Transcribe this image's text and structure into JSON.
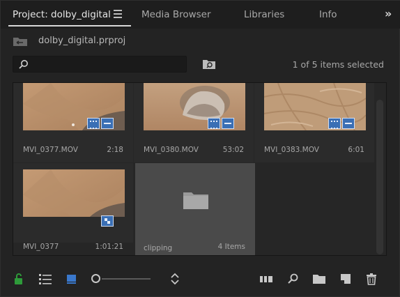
{
  "tabs": [
    {
      "label": "Project: dolby_digital",
      "active": true
    },
    {
      "label": "Media Browser",
      "active": false
    },
    {
      "label": "Libraries",
      "active": false
    },
    {
      "label": "Info",
      "active": false
    }
  ],
  "overflow_label": "»",
  "project_path": "dolby_digital.prproj",
  "search": {
    "placeholder": "",
    "value": ""
  },
  "selection_status": "1 of 5 items selected",
  "items": [
    {
      "name": "MVI_0377.MOV",
      "duration": "2:18"
    },
    {
      "name": "MVI_0380.MOV",
      "duration": "53:02"
    },
    {
      "name": "MVI_0383.MOV",
      "duration": "6:01"
    },
    {
      "name": "MVI_0377",
      "duration": "1:01:21"
    },
    {
      "name": "clipping",
      "duration": "4 Items"
    }
  ],
  "colors": {
    "accent": "#3a6fb5",
    "lock": "#2e9b3a",
    "selected_tile": "#4a4a4a"
  },
  "icons": [
    "lock-icon",
    "list-view-icon",
    "icon-view-icon",
    "zoom-slider",
    "sort-icon",
    "automate-sequence-icon",
    "find-icon",
    "new-bin-icon",
    "new-item-icon",
    "trash-icon"
  ]
}
